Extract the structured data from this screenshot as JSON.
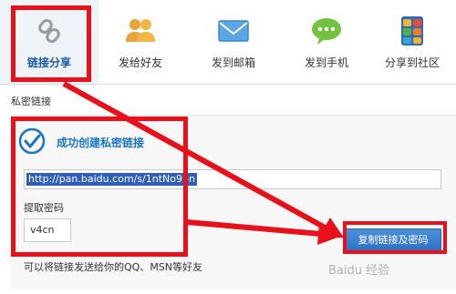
{
  "tabs": [
    {
      "label": "链接分享",
      "icon": "link-icon"
    },
    {
      "label": "发给好友",
      "icon": "friends-icon"
    },
    {
      "label": "发到邮箱",
      "icon": "mail-icon"
    },
    {
      "label": "发到手机",
      "icon": "chat-bubble-icon"
    },
    {
      "label": "分享到社区",
      "icon": "community-apps-icon"
    }
  ],
  "section_label": "私密链接",
  "success": {
    "text": "成功创建私密链接",
    "icon": "check-circle-icon"
  },
  "link": {
    "value": "http://pan.baidu.com/s/1ntNo9pn"
  },
  "code": {
    "label": "提取密码",
    "value": "v4cn"
  },
  "copy_button": {
    "label": "复制链接及密码"
  },
  "hint": "可以将链接发送给你的QQ、MSN等好友",
  "watermark": "Baidu 经验",
  "colors": {
    "annotation_red": "#e8101a",
    "accent_blue": "#1a76c4",
    "button_blue": "#2d6fc4"
  }
}
